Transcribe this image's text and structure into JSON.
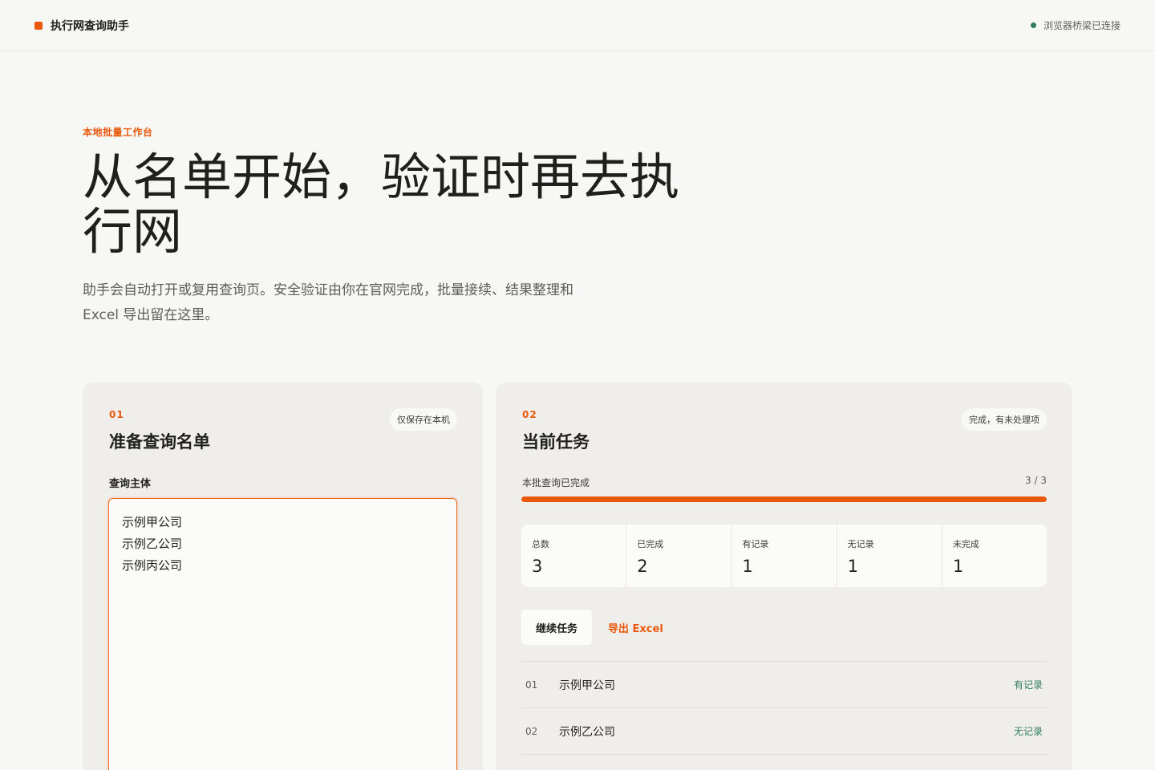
{
  "app": {
    "title": "执行网查询助手",
    "connection_status": "浏览器桥梁已连接",
    "accent": "#ea580c",
    "success": "#2e7d5b"
  },
  "hero": {
    "eyebrow": "本地批量工作台",
    "title": "从名单开始，验证时再去执行网",
    "description": "助手会自动打开或复用查询页。安全验证由你在官网完成，批量接续、结果整理和 Excel 导出留在这里。"
  },
  "prepare": {
    "step": "01",
    "title": "准备查询名单",
    "badge": "仅保存在本机",
    "field_label": "查询主体",
    "entries": [
      "示例甲公司",
      "示例乙公司",
      "示例丙公司"
    ]
  },
  "task": {
    "step": "02",
    "title": "当前任务",
    "badge": "完成，有未处理项",
    "progress_label": "本批查询已完成",
    "progress_text": "3 / 3",
    "progress_fraction": 1.0,
    "stats": [
      {
        "label": "总数",
        "value": "3"
      },
      {
        "label": "已完成",
        "value": "2"
      },
      {
        "label": "有记录",
        "value": "1"
      },
      {
        "label": "无记录",
        "value": "1"
      },
      {
        "label": "未完成",
        "value": "1"
      }
    ],
    "continue_label": "继续任务",
    "export_label": "导出 Excel",
    "results": [
      {
        "no": "01",
        "name": "示例甲公司",
        "status": "有记录"
      },
      {
        "no": "02",
        "name": "示例乙公司",
        "status": "无记录"
      }
    ]
  }
}
